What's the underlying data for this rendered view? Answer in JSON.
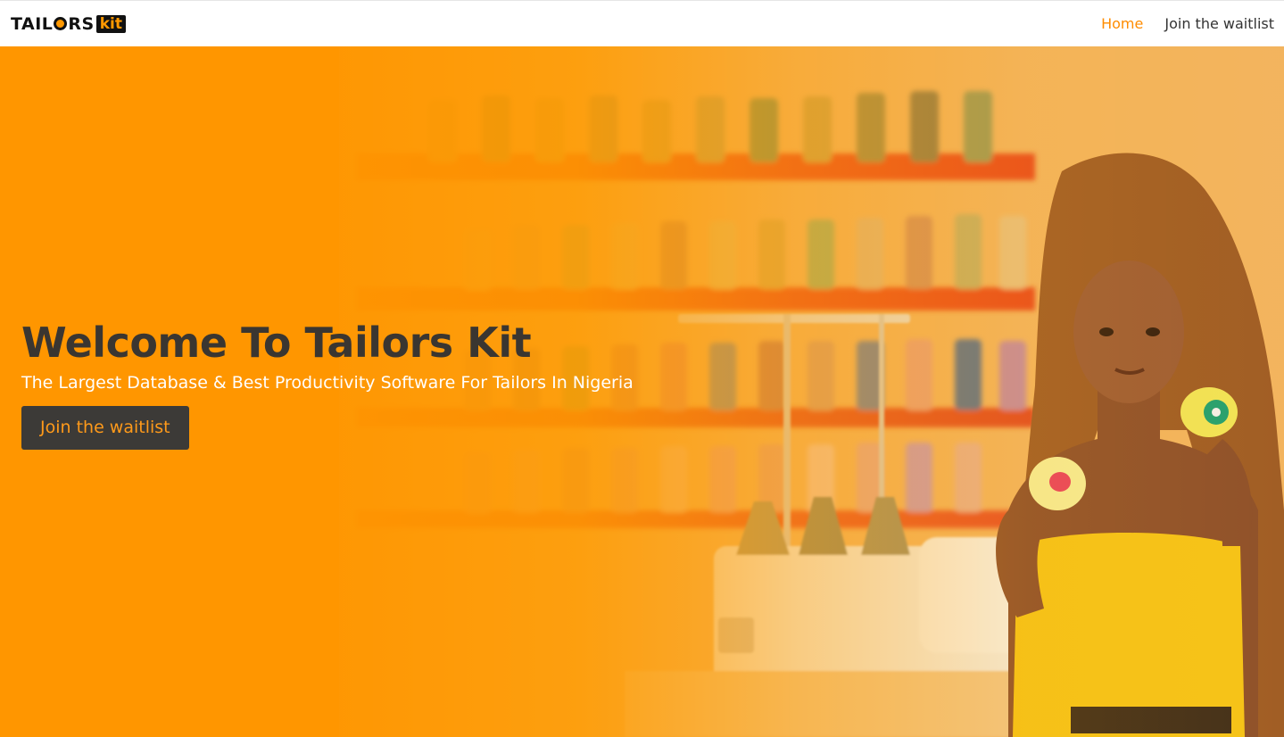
{
  "brand": {
    "logo_main": "TAIL",
    "logo_rest": "RS",
    "logo_kit": "kit",
    "accent_color": "#ff9800",
    "dark_color": "#111111"
  },
  "nav": {
    "home_label": "Home",
    "waitlist_label": "Join the waitlist",
    "active_color": "#ff8c00"
  },
  "hero": {
    "title": "Welcome To Tailors Kit",
    "subtitle": "The Largest Database & Best Productivity Software For Tailors In Nigeria",
    "cta_label": "Join the waitlist",
    "background_color": "#ff9a00",
    "image_description_icon": "tailor-woman-photo"
  }
}
